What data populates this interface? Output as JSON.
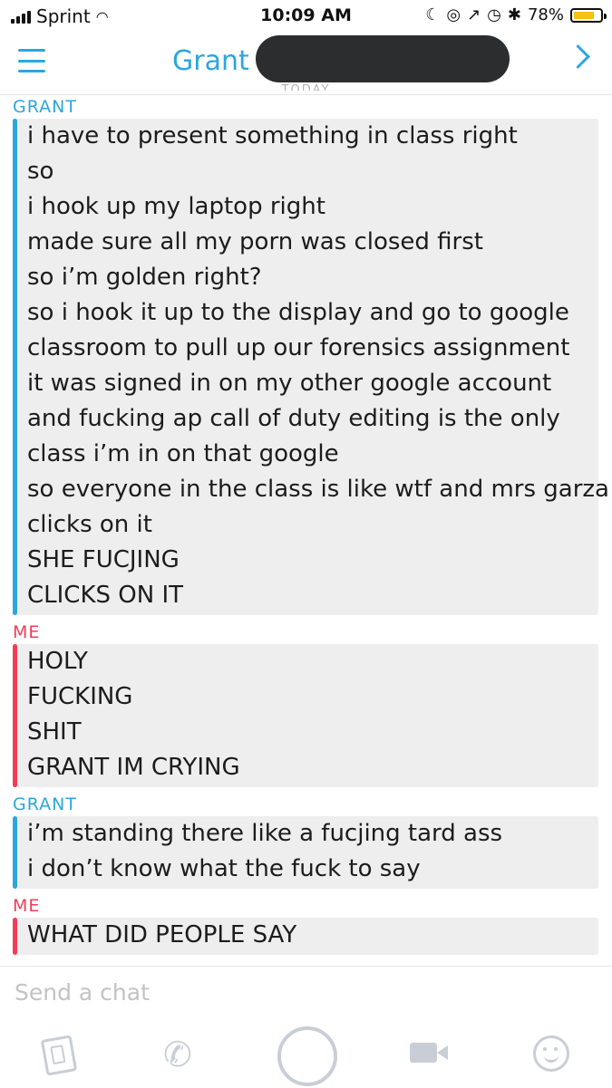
{
  "status_bar": {
    "carrier": "Sprint",
    "time": "10:09 AM",
    "battery": "78%",
    "battery_level": 0.78,
    "battery_color": "#f2c40e"
  },
  "header": {
    "contact_name": "Grant",
    "today_label": "TODAY",
    "accent_color": "#2ba6de"
  },
  "conversation": [
    {
      "sender": "GRANT",
      "lines": [
        "i have to present something in class right",
        "so",
        "i hook up my laptop right",
        "made sure all my porn was closed first",
        "so i’m golden right?",
        "so i hook it up to the display and go to google",
        "classroom to pull up our forensics assignment",
        "it was signed in on my other google account",
        "and fucking ap call of duty editing is the only",
        "class i’m in on that google",
        "so everyone in the class is like wtf and mrs garza",
        "clicks on it",
        "SHE FUCJING",
        "CLICKS ON IT"
      ]
    },
    {
      "sender": "ME",
      "lines": [
        "HOLY",
        "FUCKING",
        "SHIT",
        "GRANT IM CRYING"
      ]
    },
    {
      "sender": "GRANT",
      "lines": [
        "i’m standing there like a fucjing tard ass",
        "i don’t know what the fuck to say"
      ]
    },
    {
      "sender": "ME",
      "lines": [
        "WHAT DID PEOPLE SAY"
      ]
    }
  ],
  "composer": {
    "placeholder": "Send a chat"
  },
  "icons": [
    "memories-icon",
    "phone-icon",
    "capture-button",
    "video-icon",
    "emoji-icon"
  ]
}
